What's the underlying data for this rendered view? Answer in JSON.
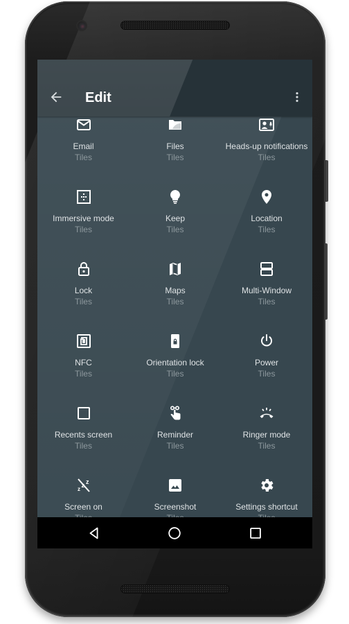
{
  "toolbar": {
    "back_icon": "arrow-back-icon",
    "title": "Edit",
    "menu_icon": "more-vert-icon"
  },
  "tiles": [
    {
      "name": "Email",
      "subtitle": "Tiles",
      "icon": "email-icon"
    },
    {
      "name": "Files",
      "subtitle": "Tiles",
      "icon": "folder-icon"
    },
    {
      "name": "Heads-up notifications",
      "subtitle": "Tiles",
      "icon": "heads-up-notification-icon"
    },
    {
      "name": "Immersive mode",
      "subtitle": "Tiles",
      "icon": "immersive-mode-icon"
    },
    {
      "name": "Keep",
      "subtitle": "Tiles",
      "icon": "lightbulb-icon"
    },
    {
      "name": "Location",
      "subtitle": "Tiles",
      "icon": "location-pin-icon"
    },
    {
      "name": "Lock",
      "subtitle": "Tiles",
      "icon": "lock-icon"
    },
    {
      "name": "Maps",
      "subtitle": "Tiles",
      "icon": "map-icon"
    },
    {
      "name": "Multi-Window",
      "subtitle": "Tiles",
      "icon": "multi-window-icon"
    },
    {
      "name": "NFC",
      "subtitle": "Tiles",
      "icon": "nfc-icon"
    },
    {
      "name": "Orientation lock",
      "subtitle": "Tiles",
      "icon": "orientation-lock-icon"
    },
    {
      "name": "Power",
      "subtitle": "Tiles",
      "icon": "power-icon"
    },
    {
      "name": "Recents screen",
      "subtitle": "Tiles",
      "icon": "recents-square-icon"
    },
    {
      "name": "Reminder",
      "subtitle": "Tiles",
      "icon": "reminder-finger-icon"
    },
    {
      "name": "Ringer mode",
      "subtitle": "Tiles",
      "icon": "ringer-icon"
    },
    {
      "name": "Screen on",
      "subtitle": "Tiles",
      "icon": "screen-on-off-icon"
    },
    {
      "name": "Screenshot",
      "subtitle": "Tiles",
      "icon": "image-icon"
    },
    {
      "name": "Settings shortcut",
      "subtitle": "Tiles",
      "icon": "settings-gear-icon"
    }
  ],
  "navbar": {
    "back": "nav-back-icon",
    "home": "nav-home-icon",
    "recents": "nav-recents-icon"
  },
  "colors": {
    "screen_bg": "#37474f",
    "toolbar_bg": "#263238",
    "primary_text": "#dfe3e5",
    "secondary_text": "#8d989d",
    "navbar_bg": "#000000"
  }
}
